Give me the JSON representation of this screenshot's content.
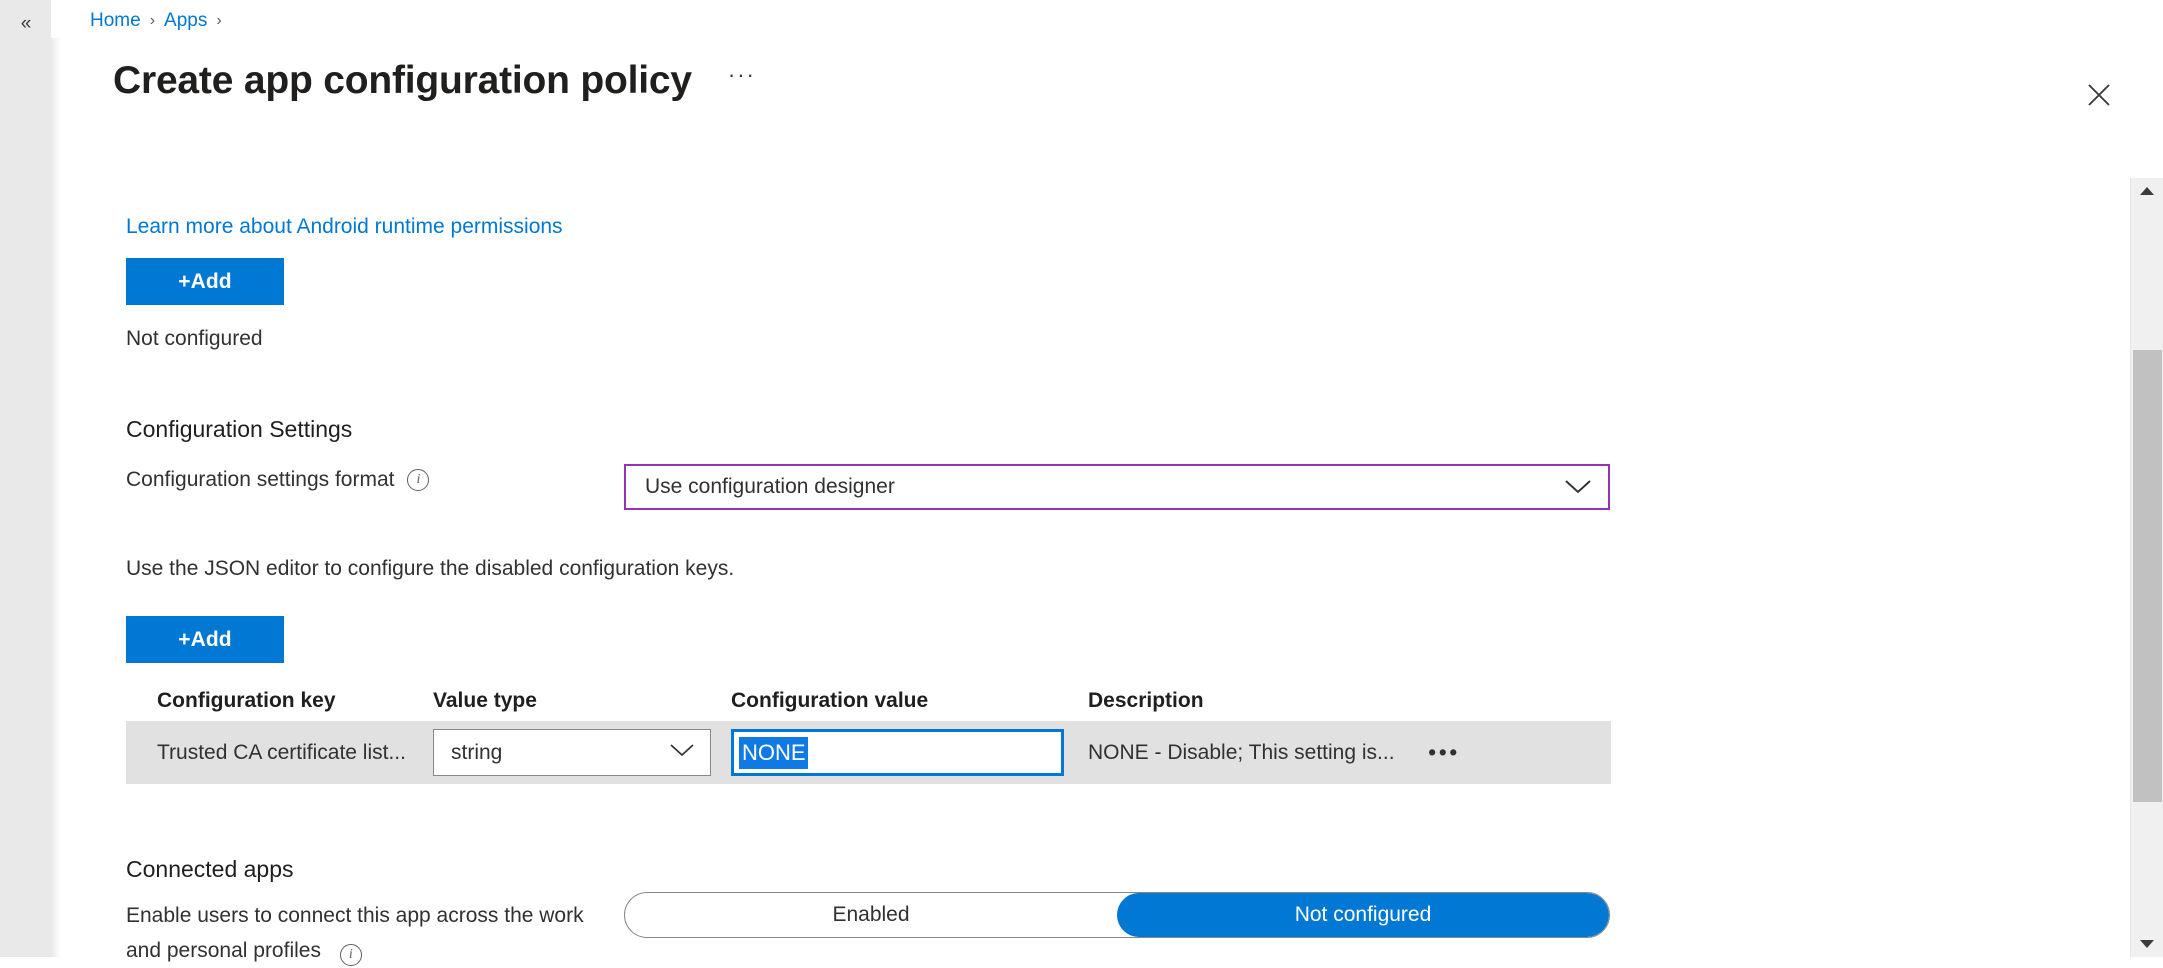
{
  "nav": {
    "collapse_icon": "double-chevron-left-icon",
    "collapse_glyph": "«"
  },
  "breadcrumb": {
    "items": [
      {
        "label": "Home"
      },
      {
        "label": "Apps"
      }
    ],
    "separator": "›"
  },
  "header": {
    "title": "Create app configuration policy",
    "more_glyph": "···",
    "more_icon": "ellipsis-horizontal-icon",
    "close_icon": "close-icon"
  },
  "main": {
    "learn_more_link": "Learn more about Android runtime permissions",
    "runtime_permissions_add_label": "+Add",
    "runtime_permissions_status": "Not configured",
    "configuration_settings_heading": "Configuration Settings",
    "configuration_settings_format_label": "Configuration settings format",
    "info_icon": "info-icon",
    "info_glyph": "i",
    "configuration_settings_format_value": "Use configuration designer",
    "chevron_down_icon": "chevron-down-icon",
    "json_editor_hint": "Use the JSON editor to configure the disabled configuration keys.",
    "configuration_keys_add_label": "+Add"
  },
  "table": {
    "columns": [
      "Configuration key",
      "Value type",
      "Configuration value",
      "Description"
    ],
    "rows": [
      {
        "configuration_key": "Trusted CA certificate list...",
        "value_type": "string",
        "configuration_value": "NONE",
        "description": "NONE - Disable; This setting is...",
        "more_glyph": "•••"
      }
    ]
  },
  "connected_apps": {
    "heading": "Connected apps",
    "description_line_1": "Enable users to connect this app across",
    "description_line_2": "the work and personal profiles",
    "toggle_options": [
      {
        "label": "Enabled",
        "selected": false
      },
      {
        "label": "Not configured",
        "selected": true
      }
    ]
  },
  "scrollbar": {
    "up_icon": "scroll-up-arrow-icon",
    "down_icon": "scroll-down-arrow-icon",
    "thumb_icon": "scrollbar-thumb"
  },
  "colors": {
    "accent_blue": "#0078d4",
    "link_blue": "#0078d4",
    "focus_border": "#0078d4",
    "selection_blue": "#0f7ae5",
    "combo_focus_purple": "#9333b5",
    "row_background": "#e1e1e1",
    "rail_background": "#e9e9e9"
  }
}
